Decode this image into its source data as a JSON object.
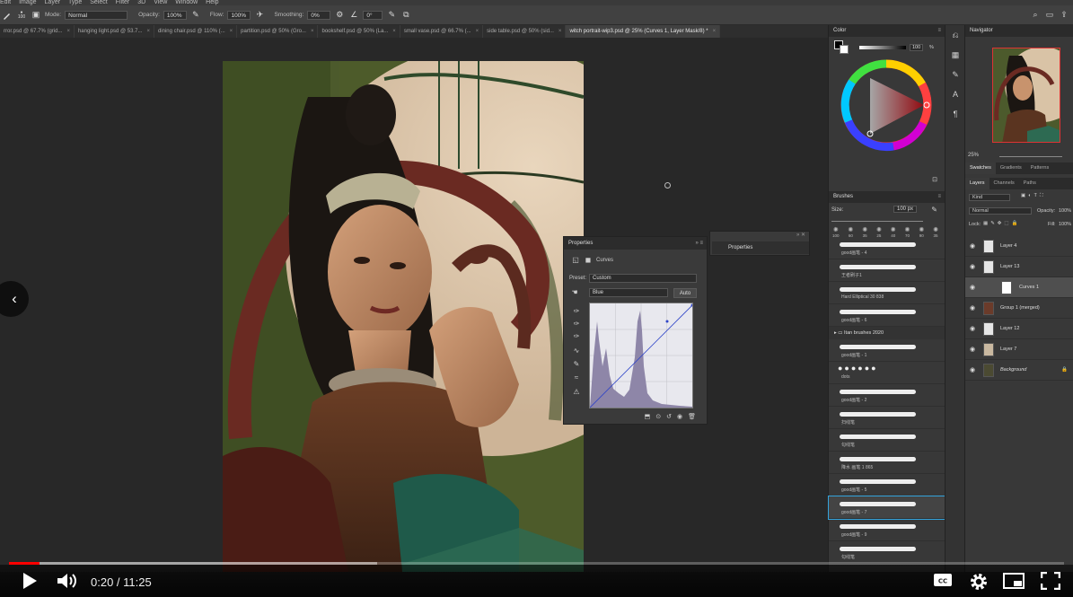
{
  "menubar": {
    "items": [
      "Edit",
      "Image",
      "Layer",
      "Type",
      "Select",
      "Filter",
      "3D",
      "View",
      "Window",
      "Help"
    ]
  },
  "options": {
    "brush_size": "100",
    "mode_label": "Mode:",
    "mode_value": "Normal",
    "opacity_label": "Opacity:",
    "opacity_value": "100%",
    "flow_label": "Flow:",
    "flow_value": "100%",
    "smoothing_label": "Smoothing:",
    "smoothing_value": "0%",
    "angle_value": "0°"
  },
  "tabs": [
    {
      "label": "rror.psd @ 67.7% (grid..."
    },
    {
      "label": "hanging light.psd @ 53.7..."
    },
    {
      "label": "dining chair.psd @ 110% (..."
    },
    {
      "label": "partition.psd @ 50% (Gro..."
    },
    {
      "label": "bookshelf.psd @ 50% (La..."
    },
    {
      "label": "small vase.psd @ 66.7% (..."
    },
    {
      "label": "side table.psd @ 50% (sid..."
    },
    {
      "label": "witch portrait-wip3.psd @ 25% (Curves 1, Layer Mask/8) *"
    }
  ],
  "properties": {
    "title": "Properties",
    "adjustment": "Curves",
    "preset_label": "Preset:",
    "preset_value": "Custom",
    "channel_value": "Blue",
    "auto_label": "Auto",
    "collapsed_title": "Properties"
  },
  "color_panel": {
    "title": "Color",
    "value": "100",
    "unit": "%"
  },
  "brushes_panel": {
    "title": "Brushes",
    "size_label": "Size:",
    "size_value": "100 px",
    "tip_sizes": [
      "100",
      "60",
      "35",
      "25",
      "40",
      "70",
      "90",
      "35"
    ],
    "items": [
      {
        "name": "good画笔 - 4"
      },
      {
        "name": "王者刷子1"
      },
      {
        "name": "Hard Elliptical 30 838"
      },
      {
        "name": "good画笔 - 6"
      }
    ],
    "group_name": "Itan brushes 2020",
    "group_items": [
      {
        "name": "good画笔 - 1"
      },
      {
        "name": "dots"
      },
      {
        "name": "good画笔 - 2"
      },
      {
        "name": "扫线笔"
      },
      {
        "name": "勾线笔"
      },
      {
        "name": "降水 画笔 1 865"
      },
      {
        "name": "good画笔 - 5"
      },
      {
        "name": "good画笔 - 7"
      },
      {
        "name": "good画笔 - 9"
      },
      {
        "name": "勾线笔"
      }
    ]
  },
  "navigator": {
    "title": "Navigator",
    "zoom": "25%"
  },
  "swatch_tabs": [
    "Swatches",
    "Gradients",
    "Patterns"
  ],
  "layer_tabs": [
    "Layers",
    "Channels",
    "Paths"
  ],
  "layers_panel": {
    "kind_label": "Kind",
    "blend_mode": "Normal",
    "opacity_label": "Opacity:",
    "opacity_value": "100%",
    "lock_label": "Lock:",
    "fill_label": "Fill:",
    "fill_value": "100%",
    "layers": [
      {
        "name": "Layer 4"
      },
      {
        "name": "Layer 13"
      },
      {
        "name": "Curves 1"
      },
      {
        "name": "Group 1 (merged)"
      },
      {
        "name": "Layer 12"
      },
      {
        "name": "Layer 7"
      },
      {
        "name": "Background"
      }
    ]
  },
  "video": {
    "time": "0:20 / 11:25",
    "progress_fraction": 0.029
  },
  "colors": {
    "accent_red": "#ff0000",
    "panel": "#383838"
  }
}
